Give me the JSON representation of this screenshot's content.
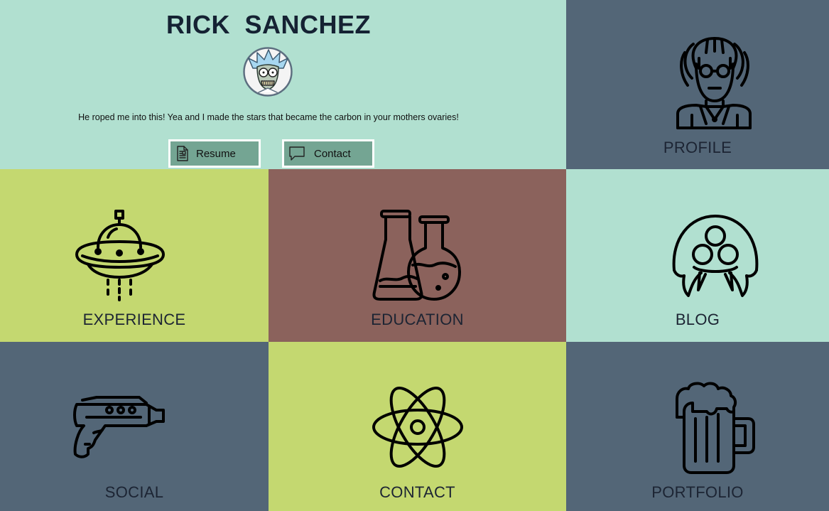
{
  "header": {
    "name": "RICK  SANCHEZ",
    "quote": "He roped me into this! Yea and I made the stars that became the carbon in your mothers ovaries!",
    "buttons": {
      "resume_label": "Resume",
      "contact_label": "Contact"
    }
  },
  "tiles": {
    "profile": "PROFILE",
    "experience": "EXPERIENCE",
    "education": "EDUCATION",
    "blog": "BLOG",
    "social": "SOCIAL",
    "contact": "CONTACT",
    "portfolio": "PORTFOLIO"
  },
  "icons": {
    "profile": "scientist-icon",
    "experience": "ufo-icon",
    "education": "flasks-icon",
    "blog": "alien-icon",
    "social": "ray-gun-icon",
    "contact": "atom-icon",
    "portfolio": "beer-mug-icon",
    "resume_button": "document-icon",
    "contact_button": "speech-bubble-icon"
  },
  "colors": {
    "mint": "#b1e0d0",
    "slate": "#536677",
    "lime": "#c4d870",
    "brown": "#8b625c",
    "button": "#74a593",
    "text": "#1c2433"
  }
}
